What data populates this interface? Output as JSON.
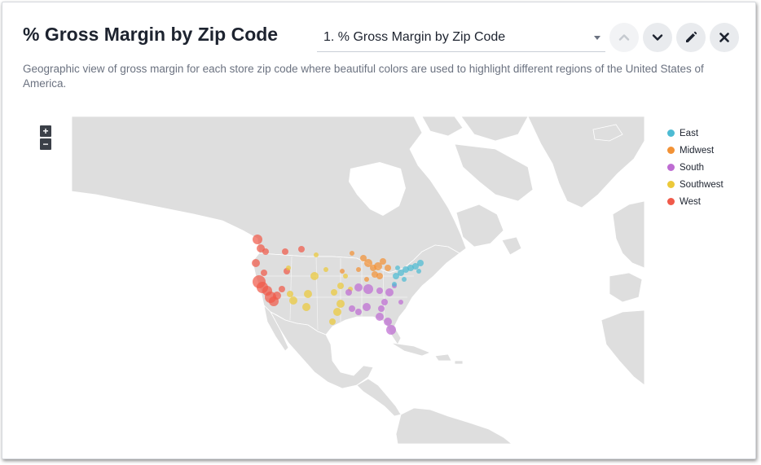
{
  "header": {
    "title": "% Gross Margin by Zip Code",
    "selector_value": "1. % Gross Margin by Zip Code",
    "description": "Geographic view of gross margin for each store zip code where beautiful colors are used to highlight different regions of the United States of America."
  },
  "buttons": {
    "up_icon": "chevron-up-icon",
    "down_icon": "chevron-down-icon",
    "edit_icon": "pencil-icon",
    "close_icon": "close-icon"
  },
  "map": {
    "zoom_in_label": "+",
    "zoom_out_label": "−",
    "colors": {
      "land": "#dedede",
      "water": "#ffffff"
    }
  },
  "legend": {
    "items": [
      {
        "label": "East",
        "color": "#4dbbd3"
      },
      {
        "label": "Midwest",
        "color": "#f29236"
      },
      {
        "label": "South",
        "color": "#be6cd2"
      },
      {
        "label": "Southwest",
        "color": "#ecc93a"
      },
      {
        "label": "West",
        "color": "#f05a4a"
      }
    ]
  }
}
